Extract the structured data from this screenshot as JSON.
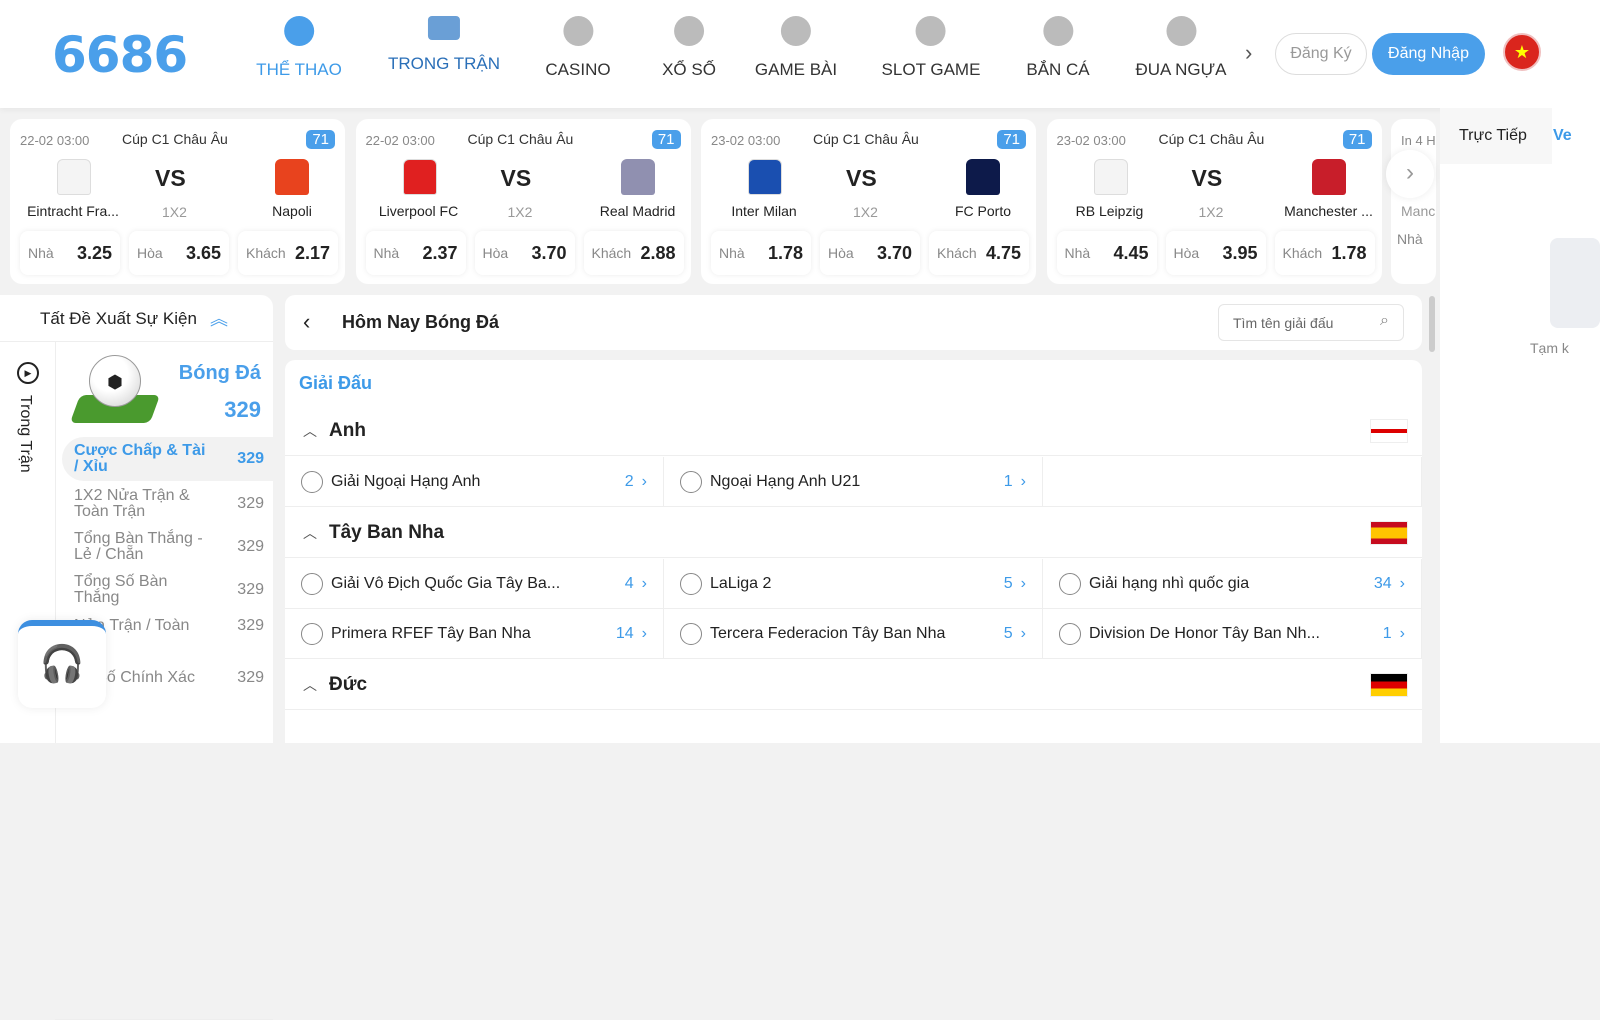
{
  "header": {
    "logo": "6686",
    "nav": [
      {
        "label": "THỂ THAO",
        "icon": "soccer-ball-icon"
      },
      {
        "label": "TRONG TRẬN",
        "icon": "video-camera-icon"
      },
      {
        "label": "CASINO",
        "icon": "cards-icon"
      },
      {
        "label": "XỔ SỐ",
        "icon": "lottery-ball-icon"
      },
      {
        "label": "GAME BÀI",
        "icon": "card-game-icon"
      },
      {
        "label": "SLOT GAME",
        "icon": "slot-machine-icon"
      },
      {
        "label": "BẮN CÁ",
        "icon": "fish-icon"
      },
      {
        "label": "ĐUA NGỰA",
        "icon": "horse-icon"
      }
    ],
    "register": "Đăng Ký",
    "login": "Đăng Nhập",
    "accent": "#4a9fea"
  },
  "matches": [
    {
      "date": "22-02 03:00",
      "league": "Cúp C1 Châu Âu",
      "count": "71",
      "home": "Eintracht Fra...",
      "away": "Napoli",
      "vs": "VS",
      "market": "1X2",
      "odds": [
        [
          "Nhà",
          "3.25"
        ],
        [
          "Hòa",
          "3.65"
        ],
        [
          "Khách",
          "2.17"
        ]
      ]
    },
    {
      "date": "22-02 03:00",
      "league": "Cúp C1 Châu Âu",
      "count": "71",
      "home": "Liverpool FC",
      "away": "Real Madrid",
      "vs": "VS",
      "market": "1X2",
      "odds": [
        [
          "Nhà",
          "2.37"
        ],
        [
          "Hòa",
          "3.70"
        ],
        [
          "Khách",
          "2.88"
        ]
      ]
    },
    {
      "date": "23-02 03:00",
      "league": "Cúp C1 Châu Âu",
      "count": "71",
      "home": "Inter Milan",
      "away": "FC Porto",
      "vs": "VS",
      "market": "1X2",
      "odds": [
        [
          "Nhà",
          "1.78"
        ],
        [
          "Hòa",
          "3.70"
        ],
        [
          "Khách",
          "4.75"
        ]
      ]
    },
    {
      "date": "23-02 03:00",
      "league": "Cúp C1 Châu Âu",
      "count": "71",
      "home": "RB Leipzig",
      "away": "Manchester ...",
      "vs": "VS",
      "market": "1X2",
      "odds": [
        [
          "Nhà",
          "4.45"
        ],
        [
          "Hòa",
          "3.95"
        ],
        [
          "Khách",
          "1.78"
        ]
      ]
    }
  ],
  "partial_match": {
    "date": "In 4 H",
    "home": "Manc",
    "odd": "Nhà"
  },
  "left": {
    "title": "Tất Đề Xuất Sự Kiện",
    "side_tab": "Trong Trận",
    "sport": "Bóng Đá",
    "sport_count": "329",
    "markets": [
      {
        "name": "Cược Chấp & Tài / Xỉu",
        "count": "329"
      },
      {
        "name": "1X2 Nửa Trận & Toàn Trận",
        "count": "329"
      },
      {
        "name": "Tổng Bàn Thắng - Lẻ / Chẵn",
        "count": "329"
      },
      {
        "name": "Tổng Số Bàn Thắng",
        "count": "329"
      },
      {
        "name": "Nửa Trận / Toàn",
        "count": "329"
      },
      {
        "name": "Tỷ Số Chính Xác",
        "count": "329"
      }
    ]
  },
  "main": {
    "title": "Hôm Nay Bóng Đá",
    "search_placeholder": "Tìm tên giải đấu",
    "section": "Giải Đấu",
    "countries": [
      {
        "name": "Anh",
        "leagues": [
          {
            "name": "Giải Ngoại Hạng Anh",
            "count": "2"
          },
          {
            "name": "Ngoại Hạng Anh U21",
            "count": "1"
          }
        ]
      },
      {
        "name": "Tây Ban Nha",
        "leagues": [
          {
            "name": "Giải Vô Địch Quốc Gia Tây Ba...",
            "count": "4"
          },
          {
            "name": "LaLiga 2",
            "count": "5"
          },
          {
            "name": "Giải hạng nhì quốc gia",
            "count": "34"
          },
          {
            "name": "Primera RFEF Tây Ban Nha",
            "count": "14"
          },
          {
            "name": "Tercera Federacion Tây Ban Nha",
            "count": "5"
          },
          {
            "name": "Division De Honor Tây Ban Nh...",
            "count": "1"
          }
        ]
      },
      {
        "name": "Đức",
        "leagues": []
      }
    ]
  },
  "right": {
    "tab_live": "Trực Tiếp",
    "tab2": "Ve",
    "empty": "Tạm k"
  }
}
